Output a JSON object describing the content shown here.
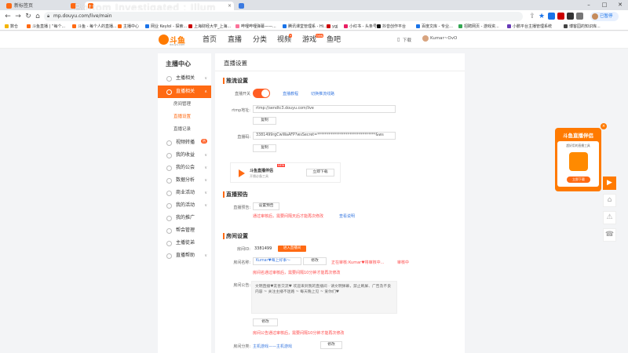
{
  "browser": {
    "tabs": [
      {
        "label": "新标签页",
        "color": "#ff6a13"
      },
      {
        "label": "",
        "color": "#ff6a13"
      },
      {
        "label": "",
        "color": "#ff6a13"
      },
      {
        "label": "",
        "color": "#3b7ae0"
      }
    ],
    "url": "mp.douyu.com/live/main",
    "bookmarks": [
      {
        "label": "数仓",
        "color": "#f4b400"
      },
      {
        "label": "斗鱼直播 | “每个...",
        "color": "#ff6a13"
      },
      {
        "label": "斗鱼 - 每个人的直播...",
        "color": "#ff6a13"
      },
      {
        "label": "主播中心",
        "color": "#ff6a13"
      },
      {
        "label": "网业 Keylol - 探索...",
        "color": "#1a73e8"
      },
      {
        "label": "上海财经大学_上海...",
        "color": "#c00"
      },
      {
        "label": "哔哩哔哩弹幕——...",
        "color": "#fb7299"
      },
      {
        "label": "腾讯课堂管理系 - Hi...",
        "color": "#1a73e8"
      },
      {
        "label": "ygj",
        "color": "#c00"
      },
      {
        "label": "小红书 - 头条号",
        "color": "#e91e63"
      },
      {
        "label": "抖音创作平台",
        "color": "#111"
      },
      {
        "label": "百度文库 - 专业…",
        "color": "#1a73e8"
      },
      {
        "label": "招聘网页 - 游戏资...",
        "color": "#34a853"
      },
      {
        "label": "小鹏平台主播管理系统",
        "color": "#673ab7"
      },
      {
        "label": "博客园的知识库...",
        "color": "#444"
      }
    ],
    "profile_label": "已暂停",
    "watermark": "Bottom Investigated : Illum"
  },
  "header": {
    "logo_text": "斗鱼",
    "logo_sub": "douyu.com",
    "nav": [
      {
        "label": "首页",
        "badge": ""
      },
      {
        "label": "直播",
        "badge": ""
      },
      {
        "label": "分类",
        "badge": ""
      },
      {
        "label": "视频",
        "badge": "•"
      },
      {
        "label": "游戏",
        "badge": "new"
      },
      {
        "label": "鱼吧",
        "badge": ""
      }
    ],
    "download_label": "下载",
    "user_label": "Kumar~OvO"
  },
  "sidebar": {
    "title": "主播中心",
    "items": [
      {
        "label": "主播相关",
        "expanded": false
      },
      {
        "label": "直播相关",
        "expanded": true
      },
      {
        "label": "视频转播",
        "expanded": false,
        "hot": "热"
      },
      {
        "label": "我的收益",
        "expanded": false
      },
      {
        "label": "我的公会",
        "expanded": false
      },
      {
        "label": "数据分析",
        "expanded": false
      },
      {
        "label": "商业活动",
        "expanded": false
      },
      {
        "label": "我的活动",
        "expanded": false
      },
      {
        "label": "我的推广",
        "expanded": false
      },
      {
        "label": "帮会管理",
        "expanded": false
      },
      {
        "label": "主播徒弟",
        "expanded": false
      },
      {
        "label": "直播帮助",
        "expanded": false
      }
    ],
    "sub_items": [
      "房间管理",
      "直播设置",
      "直播记录"
    ],
    "active_sub": 1,
    "accent": "#ff6a13"
  },
  "main": {
    "title": "直播设置",
    "push": {
      "section": "推流设置",
      "switch_label": "直播开关",
      "switch_on": true,
      "link1": "直播教程",
      "link2": "切换推流线路",
      "rtmp_label": "rtmp地址:",
      "rtmp_value": "rtmp://sendtc3.douyu.com/live",
      "copy1": "复制",
      "code_label": "直播码:",
      "code_value": "3381499rgCwWaAFP?wsSecret=*******************************&ws",
      "copy2": "复制",
      "promo_title": "斗鱼直播伴侣",
      "promo_new": "NEW",
      "promo_sub": "开播必备工具",
      "promo_btn": "立即下载"
    },
    "preview": {
      "section": "直播预告",
      "label": "直播预告:",
      "btn": "设置预告",
      "warn": "通过审核后，需要间隔天后才能再次修改",
      "link": "查看说明"
    },
    "room": {
      "section": "房间设置",
      "id_label": "房间ID:",
      "id_value": "3381499",
      "enter_btn": "进入直播间",
      "name_label": "房间名称:",
      "name_value": "Kumar♥每上好事～",
      "edit_btn": "修改",
      "name_tip_label": "正在审核:",
      "name_tip": "Kumar♥将审核中...",
      "name_tip_status": "审核中",
      "name_warn": "房间名通过审核后，需要间隔10分钟才能再次修改",
      "notice_label": "房间公告:",
      "notice_value": "文明直播♥友善交流♥ 欢迎来到我的直播间 · 请文明弹幕，禁止刷屏、广告及不良内容 ~ 关注主播不迷路 ~ 每天晚上见 ~ 爱你们♥",
      "notice_edit_btn": "修改",
      "notice_warn": "房间公告通过审核后，需要间隔10分钟才能再次修改",
      "cat_label": "房间分类:",
      "cat_value": "主机游戏——主机游戏",
      "cat_btn": "修改"
    }
  },
  "float_ad": {
    "title": "斗鱼直播伴侣",
    "sub": "超好用的直播工具",
    "btn": "立即下载",
    "close": "×"
  },
  "side_tools": [
    "▶",
    "⌂",
    "⚠",
    "☎"
  ]
}
